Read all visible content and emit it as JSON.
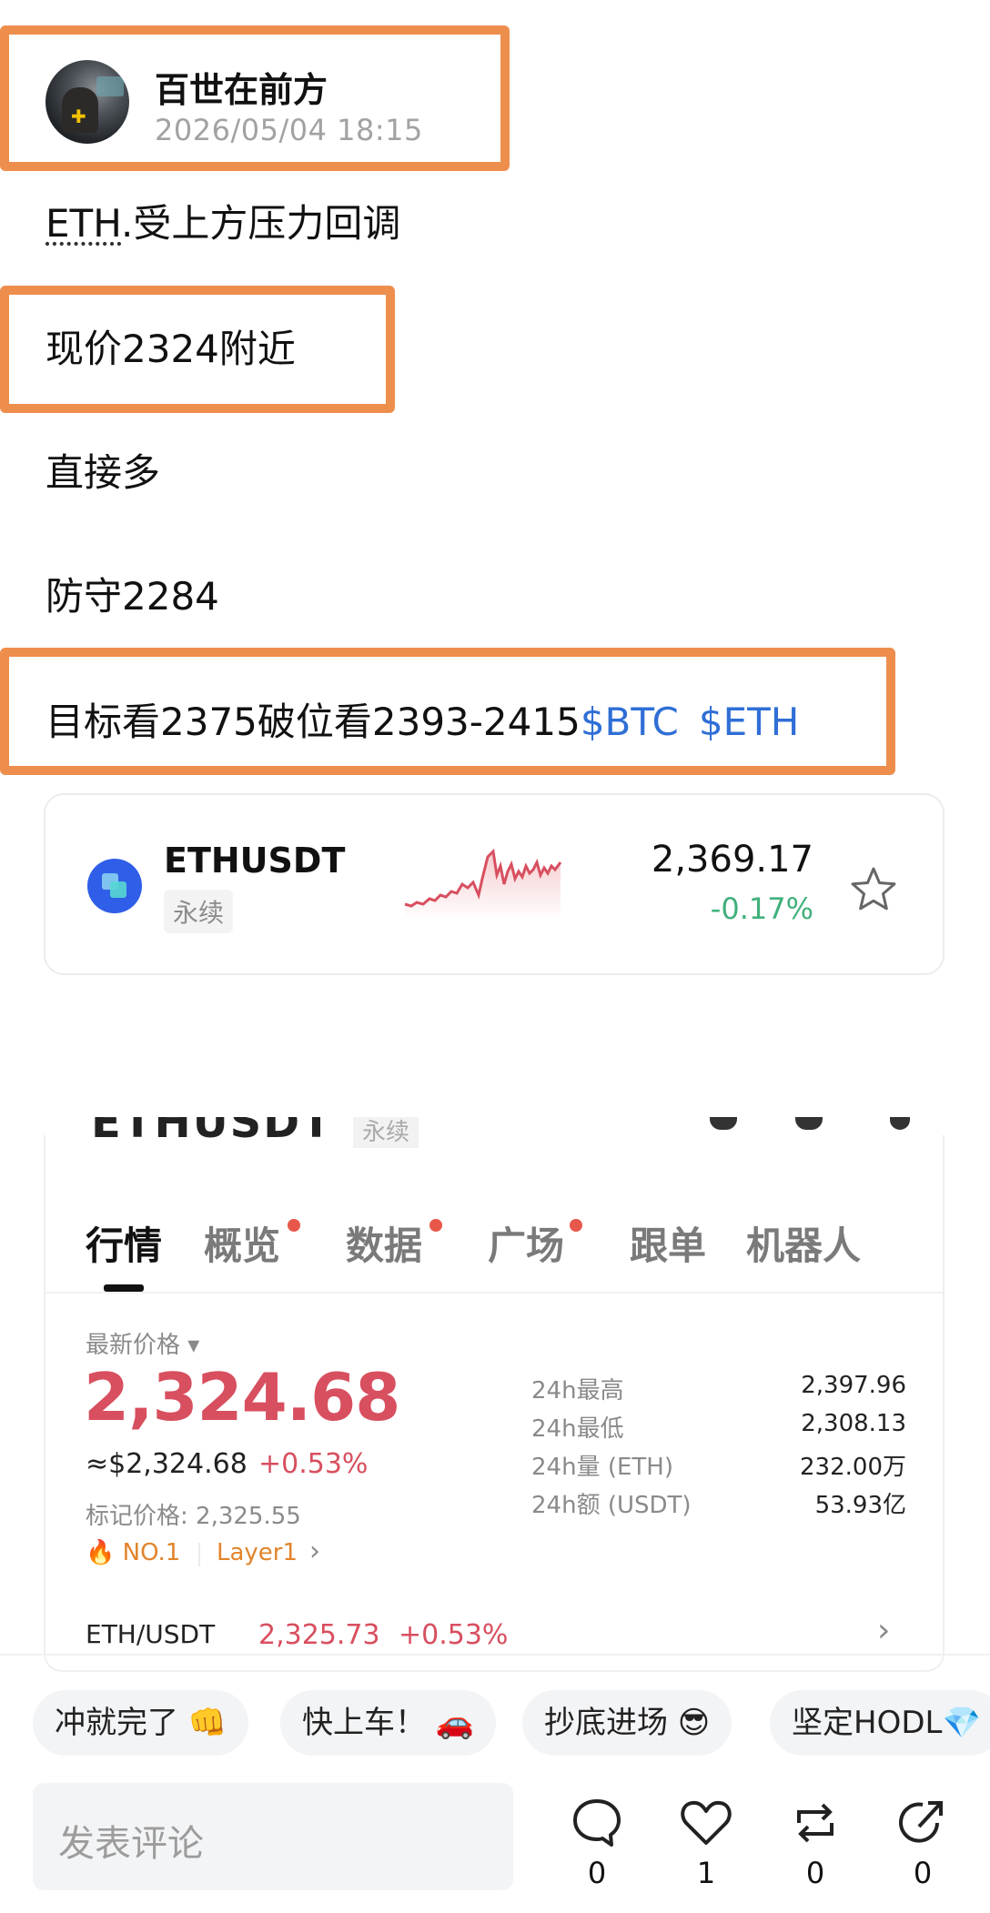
{
  "author": {
    "name": "百世在前方",
    "time": "2026/05/04 18:15"
  },
  "post": {
    "line1_ticker": "ETH",
    "line1_rest": ".受上方压力回调",
    "line2": "现价2324附近",
    "line3": "直接多",
    "line4": "防守2284",
    "line5": "目标看2375破位看2393-2415",
    "tag1": "$BTC",
    "tag2": "$ETH"
  },
  "card": {
    "pair": "ETHUSDT",
    "badge": "永续",
    "price": "2,369.17",
    "change": "-0.17%",
    "icon_logo": "eth-coin-icon",
    "icon_star": "star-icon"
  },
  "screenshot": {
    "header_title": "ETHUSDT",
    "header_badge": "永续",
    "tabs": [
      "行情",
      "概览",
      "数据",
      "广场",
      "跟单",
      "机器人"
    ],
    "latest_label": "最新价格 ▾",
    "last_price": "2,324.68",
    "usd_price": "≈$2,324.68",
    "usd_change": "+0.53%",
    "mark_price": "标记价格: 2,325.55",
    "rank": "🔥 NO.1",
    "layer": "Layer1",
    "chev": "›",
    "stats": [
      {
        "label": "24h最高",
        "value": "2,397.96"
      },
      {
        "label": "24h最低",
        "value": "2,308.13"
      },
      {
        "label": "24h量 (ETH)",
        "value": "232.00万"
      },
      {
        "label": "24h额 (USDT)",
        "value": "53.93亿"
      }
    ],
    "pair2": "ETH/USDT",
    "pair2_price": "2,325.73",
    "pair2_change": "+0.53%"
  },
  "chips": [
    "冲就完了 👊",
    "快上车！ 🚗",
    "抄底进场 😎",
    "坚定HODL💎"
  ],
  "comment": {
    "placeholder": "发表评论"
  },
  "actions": [
    {
      "icon": "comment-icon",
      "count": "0"
    },
    {
      "icon": "heart-icon",
      "count": "1"
    },
    {
      "icon": "repost-icon",
      "count": "0"
    },
    {
      "icon": "share-icon",
      "count": "0"
    }
  ],
  "colors": {
    "highlight": "#ee8e4d",
    "up": "#d84f5f",
    "down": "#41b07c",
    "link": "#2f6fd6"
  }
}
